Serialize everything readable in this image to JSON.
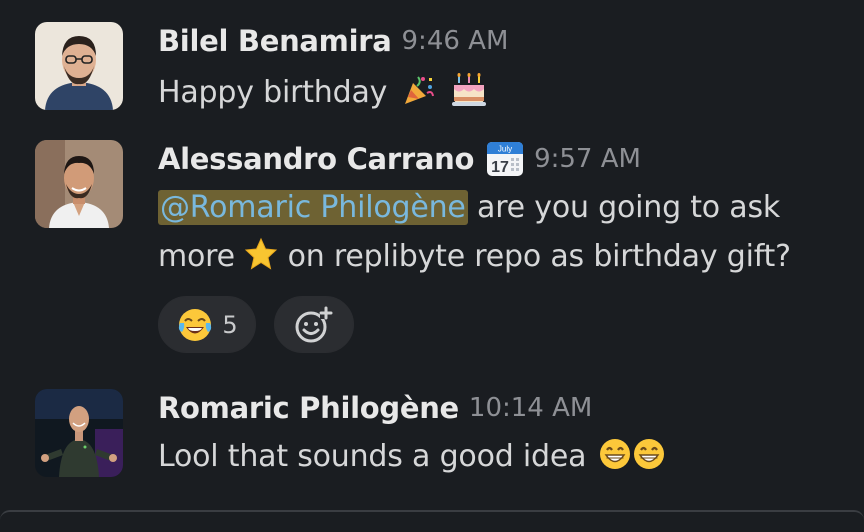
{
  "messages": [
    {
      "author": "Bilel Benamira",
      "time": "9:46 AM",
      "text": "Happy birthday",
      "emojis": [
        "party-popper",
        "birthday-cake"
      ]
    },
    {
      "author": "Alessandro Carrano",
      "status_emoji": "calendar",
      "calendar_day": "17",
      "calendar_month": "July",
      "time": "9:57 AM",
      "mention": "@Romaric Philogène",
      "text_part1": " are you going to ask",
      "text_part2": "more",
      "text_part3": " on replibyte repo as birthday gift?",
      "reactions": [
        {
          "emoji": "joy",
          "count": "5"
        }
      ]
    },
    {
      "author": "Romaric Philogène",
      "time": "10:14 AM",
      "text": "Lool that sounds a good idea",
      "emojis": [
        "grin",
        "grin"
      ]
    }
  ],
  "colors": {
    "background": "#1a1d21",
    "mention_bg": "#6e6233",
    "mention_text": "#79b8dd",
    "reaction_bg": "#2b2d31"
  }
}
